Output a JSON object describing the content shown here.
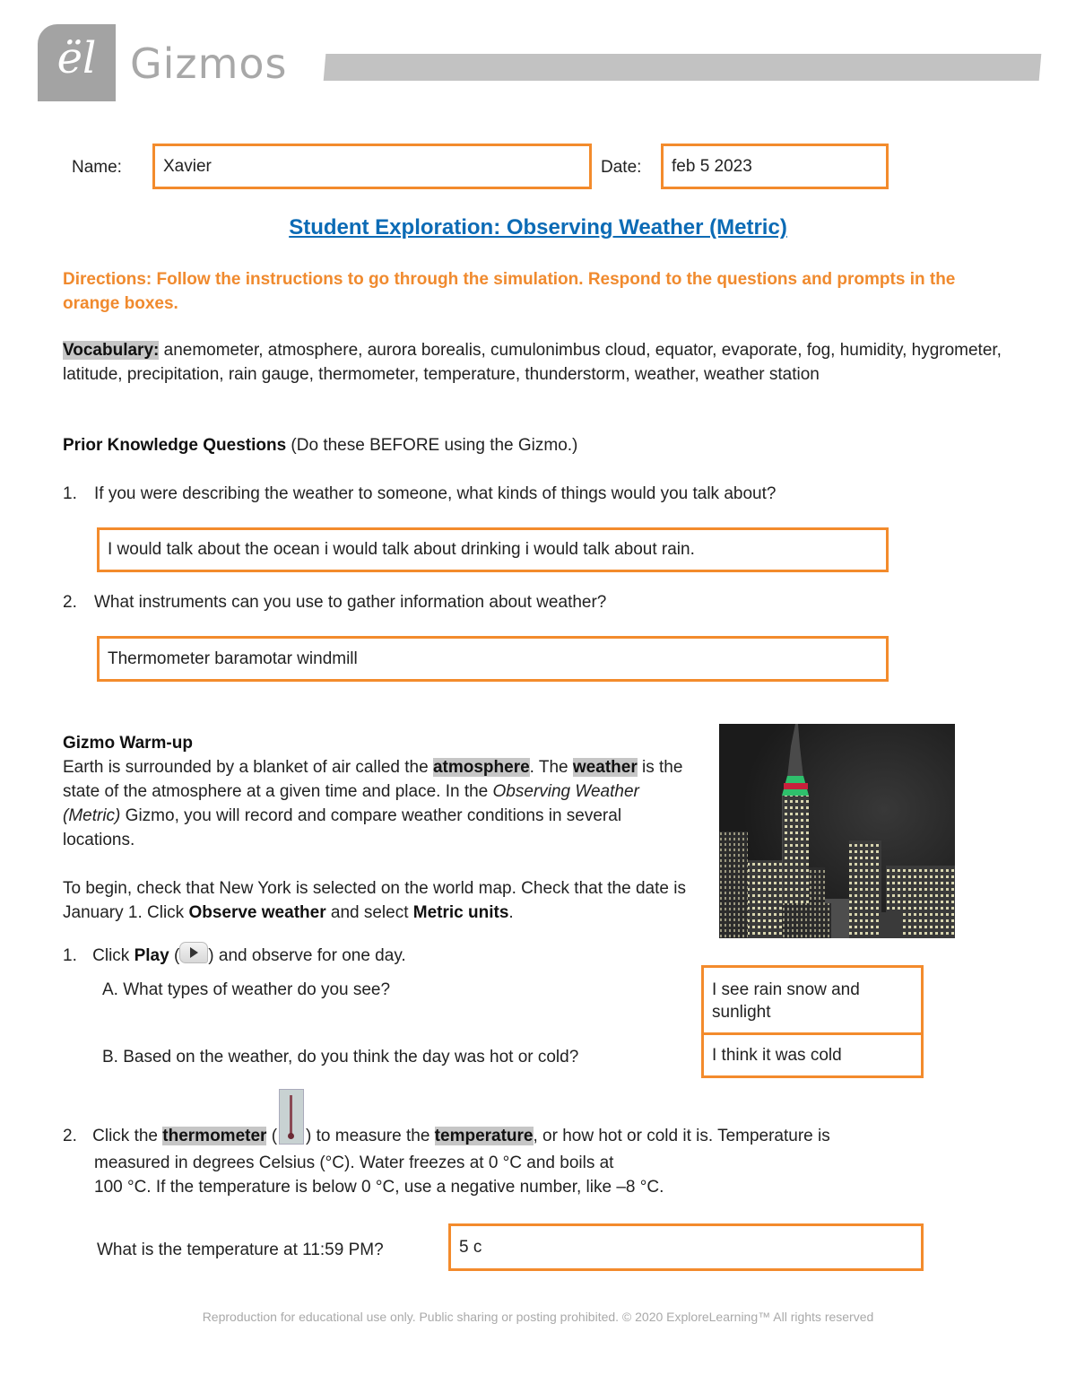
{
  "header": {
    "logo_glyph": "ël",
    "logo_text": "Gizmos"
  },
  "form": {
    "name_label": "Name:",
    "name_value": "Xavier",
    "date_label": "Date:",
    "date_value": "feb 5 2023"
  },
  "title": "Student Exploration: Observing Weather (Metric)",
  "directions": "Directions: Follow the instructions to go through the simulation. Respond to the questions and prompts in the orange boxes.",
  "vocabulary": {
    "label": "Vocabulary:",
    "terms": " anemometer, atmosphere, aurora borealis, cumulonimbus cloud, equator, evaporate, fog, humidity, hygrometer, latitude, precipitation, rain gauge, thermometer, temperature, thunderstorm, weather, weather station"
  },
  "prior_knowledge": {
    "heading": "Prior Knowledge Questions",
    "note": " (Do these BEFORE using the Gizmo.)",
    "questions": [
      {
        "number": "1.",
        "text": "If you were describing the weather to someone, what kinds of things would you talk about?",
        "answer": "I would talk about the ocean i would talk about drinking i would talk about rain."
      },
      {
        "number": "2.",
        "text": "What instruments can you use to gather information about weather?",
        "answer": "Thermometer baramotar windmill"
      }
    ]
  },
  "warmup": {
    "heading": "Gizmo Warm-up",
    "p1_a": "Earth is surrounded by a blanket of air called the ",
    "p1_term1": "atmosphere",
    "p1_b": ". The ",
    "p1_term2": "weather",
    "p1_c": " is the state of the atmosphere at a given time and place. In the ",
    "p1_italic": "Observing Weather (Metric)",
    "p1_d": " Gizmo, you will record and compare weather conditions in several locations.",
    "p2_a": "To begin, check that New York is selected on the world map. Check that the date is January 1. Click ",
    "p2_bold1": "Observe weather",
    "p2_b": " and select ",
    "p2_bold2": "Metric units",
    "p2_c": ".",
    "image_alt": "New York city skyline at night"
  },
  "q1": {
    "number": "1.",
    "pre": "Click ",
    "bold": "Play",
    "open": " (",
    "post": ") and observe for one day.",
    "a_text": "A. What types of weather do you see?",
    "a_answer": "I see rain snow and sunlight",
    "b_text": "B. Based on the weather, do you think the day was hot or cold?",
    "b_answer": "I think it was cold"
  },
  "q2": {
    "number": "2.",
    "pre": "Click the ",
    "term1": "thermometer",
    "open": " (",
    "mid": ") to measure the ",
    "term2": "temperature",
    "post": ", or how hot or cold it is. Temperature is measured in degrees Celsius (°C). Water freezes at 0 °C and boils at",
    "line3": "100 °C. If the temperature is below 0 °C, use a negative number, like –8 °C.",
    "prompt": "What is the temperature at 11:59 PM?",
    "answer": "5 c"
  },
  "footer": "Reproduction for educational use only. Public sharing or posting prohibited. © 2020 ExploreLearning™ All rights reserved"
}
